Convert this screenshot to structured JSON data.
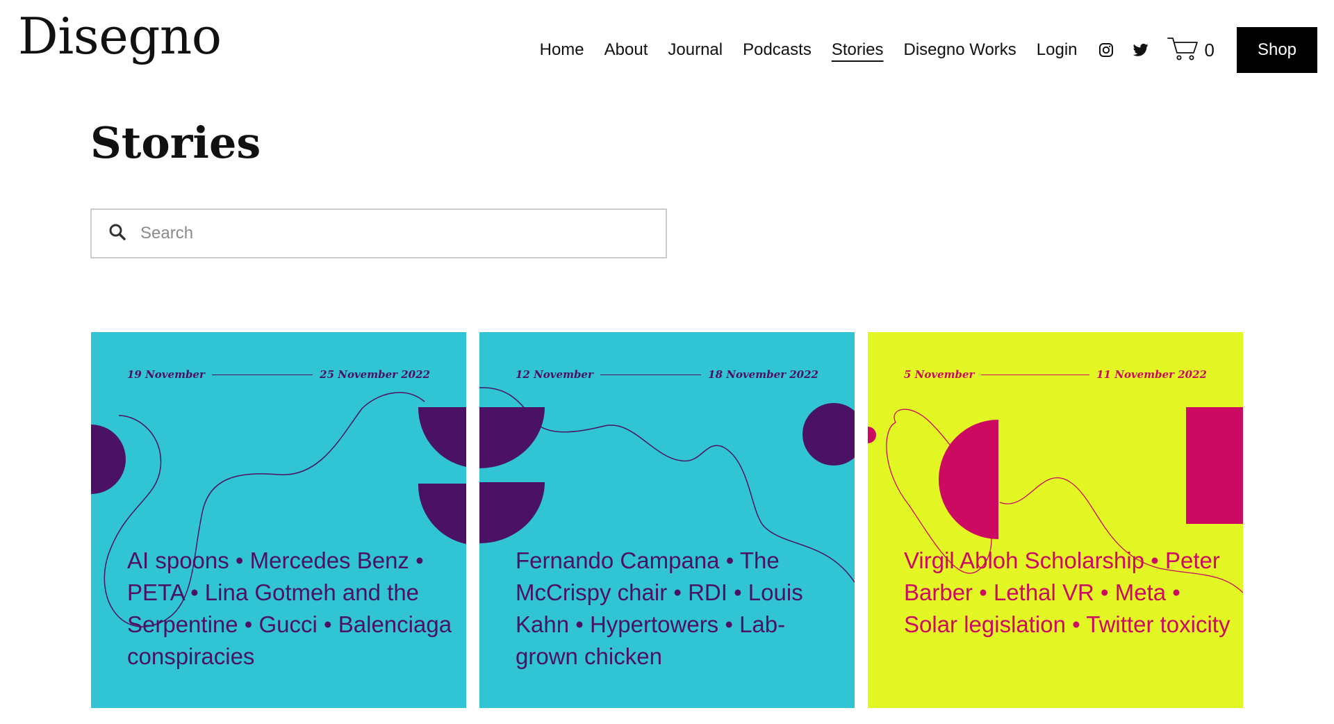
{
  "brand": {
    "logo": "Disegno"
  },
  "nav": {
    "items": [
      {
        "label": "Home"
      },
      {
        "label": "About"
      },
      {
        "label": "Journal"
      },
      {
        "label": "Podcasts"
      },
      {
        "label": "Stories",
        "active": true
      },
      {
        "label": "Disegno Works"
      },
      {
        "label": "Login"
      }
    ],
    "icons": [
      "instagram-icon",
      "twitter-icon",
      "cart-icon"
    ],
    "cart_count": "0",
    "shop_label": "Shop"
  },
  "page": {
    "title": "Stories"
  },
  "search": {
    "placeholder": "Search",
    "value": ""
  },
  "colors": {
    "cyan": "#31C4D4",
    "purple": "#4A1165",
    "lime": "#E2F723",
    "magenta": "#CC0A62"
  },
  "cards": [
    {
      "date_start": "19 November",
      "date_end": "25 November 2022",
      "text": "AI spoons • Mercedes Benz • PETA • Lina Gotmeh and the Serpentine • Gucci • Balenciaga conspiracies",
      "bg": "#31C4D4",
      "fg": "#4A1165"
    },
    {
      "date_start": "12 November",
      "date_end": "18 November 2022",
      "text": "Fernando Campana • The McCrispy chair • RDI • Louis Kahn • Hypertowers • Lab-grown chicken",
      "bg": "#31C4D4",
      "fg": "#4A1165"
    },
    {
      "date_start": "5 November",
      "date_end": "11 November 2022",
      "text": "Virgil Abloh Scholarship • Peter Barber • Lethal VR • Meta • Solar legislation • Twitter toxicity",
      "bg": "#E2F723",
      "fg": "#CC0A62"
    }
  ]
}
